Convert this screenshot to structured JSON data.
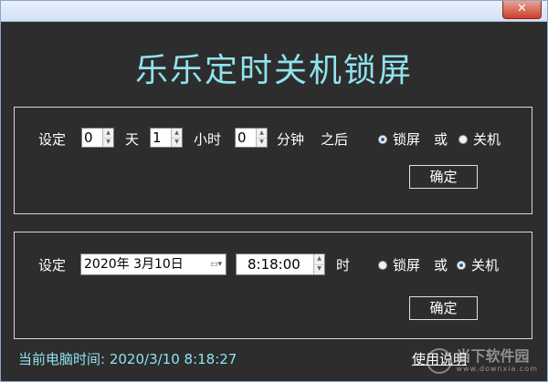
{
  "window": {
    "close_glyph": "✕"
  },
  "app": {
    "title": "乐乐定时关机锁屏"
  },
  "countdown": {
    "label_set": "设定",
    "days_value": "0",
    "days_unit": "天",
    "hours_value": "1",
    "hours_unit": "小时",
    "minutes_value": "0",
    "minutes_unit": "分钟",
    "after_label": "之后",
    "option_lock": "锁屏",
    "or_label": "或",
    "option_shutdown": "关机",
    "selected_option": "lock",
    "confirm_label": "确定"
  },
  "scheduled": {
    "label_set": "设定",
    "date_value": "2020年  3月10日",
    "time_value": "8:18:00",
    "time_unit": "时",
    "option_lock": "锁屏",
    "or_label": "或",
    "option_shutdown": "关机",
    "selected_option": "shutdown",
    "confirm_label": "确定"
  },
  "footer": {
    "current_time_label": "当前电脑时间:",
    "current_time_value": "2020/3/10  8:18:27",
    "help_label": "使用说明"
  },
  "watermark": {
    "text_cn": "当下软件园",
    "text_en": "www.downxia.com"
  },
  "colors": {
    "background": "#2d2d2d",
    "accent_cyan": "#8fe3ee",
    "text": "#ffffff",
    "close_button": "#c9402b"
  }
}
